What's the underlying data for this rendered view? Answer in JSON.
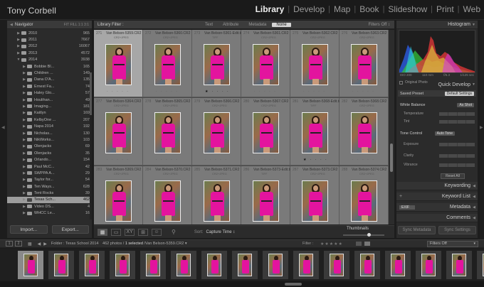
{
  "identity_plate": "Tony Corbell",
  "modules": [
    "Library",
    "Develop",
    "Map",
    "Book",
    "Slideshow",
    "Print",
    "Web"
  ],
  "active_module": "Library",
  "navigator": {
    "title": "Navigator",
    "fit_modes": "FIT FILL 1:1 3:1"
  },
  "folders": [
    {
      "name": "2010",
      "count": "965",
      "indent": 1
    },
    {
      "name": "2011",
      "count": "7667",
      "indent": 1
    },
    {
      "name": "2012",
      "count": "16067",
      "indent": 1
    },
    {
      "name": "2013",
      "count": "4572",
      "indent": 1
    },
    {
      "name": "2014",
      "count": "3938",
      "indent": 1,
      "expanded": true
    },
    {
      "name": "Bobbie Bl...",
      "count": "165",
      "indent": 2
    },
    {
      "name": "Children ...",
      "count": "149",
      "indent": 2
    },
    {
      "name": "Dana O'A...",
      "count": "135",
      "indent": 2
    },
    {
      "name": "Ernest Fa...",
      "count": "74",
      "indent": 2
    },
    {
      "name": "Haley Glo...",
      "count": "57",
      "indent": 2
    },
    {
      "name": "Houlihan...",
      "count": "49",
      "indent": 2
    },
    {
      "name": "Imaging...",
      "count": "181",
      "indent": 2
    },
    {
      "name": "Kaitlyn",
      "count": "169",
      "indent": 2
    },
    {
      "name": "KelbyOne ...",
      "count": "207",
      "indent": 2
    },
    {
      "name": "Napa 2014",
      "count": "192",
      "indent": 2
    },
    {
      "name": "Nicholas...",
      "count": "130",
      "indent": 2
    },
    {
      "name": "NikWorks...",
      "count": "103",
      "indent": 2
    },
    {
      "name": "Olenjacks",
      "count": "69",
      "indent": 2
    },
    {
      "name": "Olenjacks",
      "count": "35",
      "indent": 2
    },
    {
      "name": "Orlando...",
      "count": "154",
      "indent": 2
    },
    {
      "name": "Paul McC...",
      "count": "42",
      "indent": 2
    },
    {
      "name": "SWPPA A...",
      "count": "29",
      "indent": 2
    },
    {
      "name": "Taylor for...",
      "count": "54",
      "indent": 2
    },
    {
      "name": "Ten Ways...",
      "count": "628",
      "indent": 2
    },
    {
      "name": "Tent Rocks",
      "count": "39",
      "indent": 2
    },
    {
      "name": "Texas Sch...",
      "count": "462",
      "indent": 2,
      "selected": true
    },
    {
      "name": "Video DS...",
      "count": "4",
      "indent": 2
    },
    {
      "name": "WHCC Le...",
      "count": "16",
      "indent": 2
    }
  ],
  "left_buttons": {
    "import": "Import...",
    "export": "Export..."
  },
  "filter_bar": {
    "title": "Library Filter :",
    "options": [
      "Text",
      "Attribute",
      "Metadata",
      "None"
    ],
    "active": "None",
    "status": "Filters Off ↕"
  },
  "grid_cells": [
    {
      "index": "271",
      "name": "Van Belson-5359.CR2",
      "type": "CR2+JPEG",
      "rating": 0,
      "selected": true
    },
    {
      "index": "272",
      "name": "Van Belson-5360.CR2",
      "type": "CR2+JPEG",
      "rating": 0
    },
    {
      "index": "273",
      "name": "Van Belson-5361-Edit.tif",
      "type": "TIFF",
      "rating": 1
    },
    {
      "index": "274",
      "name": "Van Belson-5361.CR2",
      "type": "CR2+JPEG",
      "rating": 0
    },
    {
      "index": "275",
      "name": "Van Belson-5362.CR2",
      "type": "CR2+JPEG",
      "rating": 0
    },
    {
      "index": "276",
      "name": "Van Belson-5363.CR2",
      "type": "CR2+JPEG",
      "rating": 0
    },
    {
      "index": "277",
      "name": "Van Belson-5364.CR2",
      "type": "CR2+JPEG",
      "rating": 0
    },
    {
      "index": "278",
      "name": "Van Belson-5365.CR2",
      "type": "CR2+JPEG",
      "rating": 0
    },
    {
      "index": "279",
      "name": "Van Belson-5366.CR2",
      "type": "CR2+JPEG",
      "rating": 0
    },
    {
      "index": "280",
      "name": "Van Belson-5367.CR2",
      "type": "CR2+JPEG",
      "rating": 0
    },
    {
      "index": "281",
      "name": "Van Belson-5368-Edit.tif",
      "type": "TIFF",
      "rating": 1
    },
    {
      "index": "282",
      "name": "Van Belson-5368.CR2",
      "type": "CR2+JPEG",
      "rating": 0
    },
    {
      "index": "283",
      "name": "Van Belson-5369.CR2",
      "type": "CR2+JPEG",
      "rating": 0
    },
    {
      "index": "284",
      "name": "Van Belson-5370.CR2",
      "type": "CR2+JPEG",
      "rating": 0
    },
    {
      "index": "285",
      "name": "Van Belson-5371.CR2",
      "type": "CR2+JPEG",
      "rating": 0
    },
    {
      "index": "286",
      "name": "Van Belson-5373-Edit.tif",
      "type": "TIFF",
      "rating": 0
    },
    {
      "index": "287",
      "name": "Van Belson-5373.CR2",
      "type": "CR2+JPEG",
      "rating": 0
    },
    {
      "index": "288",
      "name": "Van Belson-5374.CR2",
      "type": "CR2+JPEG",
      "rating": 0
    }
  ],
  "toolbar": {
    "sort_label": "Sort:",
    "sort_value": "Capture Time ↕",
    "thumbnails_label": "Thumbnails"
  },
  "histogram": {
    "title": "Histogram",
    "iso": "ISO 200",
    "focal": "110 mm",
    "aperture": "f/6.3",
    "shutter": "1/125 sec"
  },
  "original_photo": "Original Photo",
  "quick_develop": {
    "title": "Quick Develop",
    "saved_preset_label": "Saved Preset",
    "saved_preset_value": "Default Settings",
    "white_balance_label": "White Balance",
    "white_balance_value": "As Shot",
    "temperature": "Temperature",
    "tint": "Tint",
    "tone_control_label": "Tone Control",
    "tone_control_value": "Auto Tone",
    "exposure": "Exposure",
    "clarity": "Clarity",
    "vibrance": "Vibrance",
    "reset_all": "Reset All"
  },
  "right_sections": {
    "keywording": "Keywording",
    "keyword_list": "Keyword List",
    "metadata": "Metadata",
    "metadata_preset": "EXIF",
    "comments": "Comments"
  },
  "right_buttons": {
    "sync_metadata": "Sync Metadata",
    "sync_settings": "Sync Settings"
  },
  "filmstrip_bar": {
    "screen1": "1",
    "screen2": "2",
    "path_prefix": "Folder : Texas School 2014",
    "path_count": "462 photos /",
    "path_selected": "1 selected",
    "path_file": "/Van Belson-5359.CR2 ▾",
    "filter_label": "Filter :",
    "filter_status": "Filters Off"
  },
  "colors": {
    "accent_pink": "#e3149e",
    "selected_gray": "#a7a7a7"
  }
}
